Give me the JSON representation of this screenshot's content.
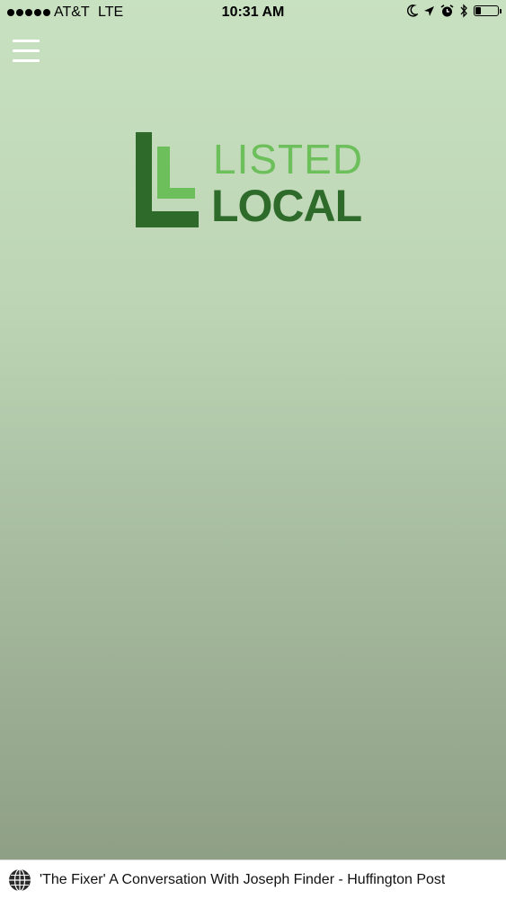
{
  "status_bar": {
    "carrier": "AT&T",
    "network": "LTE",
    "time": "10:31 AM",
    "icons": [
      "moon-icon",
      "location-arrow-icon",
      "alarm-icon",
      "bluetooth-icon",
      "battery-icon"
    ],
    "battery_level": 0.25
  },
  "header": {
    "menu_icon": "hamburger-menu-icon"
  },
  "logo": {
    "line1": "LISTED",
    "line2": "LOCAL",
    "colors": {
      "light": "#6cbf5a",
      "dark": "#2e6b2b"
    }
  },
  "news_ticker": {
    "icon": "globe-icon",
    "headline": "'The Fixer' A Conversation With Joseph Finder - Huffington Post"
  }
}
